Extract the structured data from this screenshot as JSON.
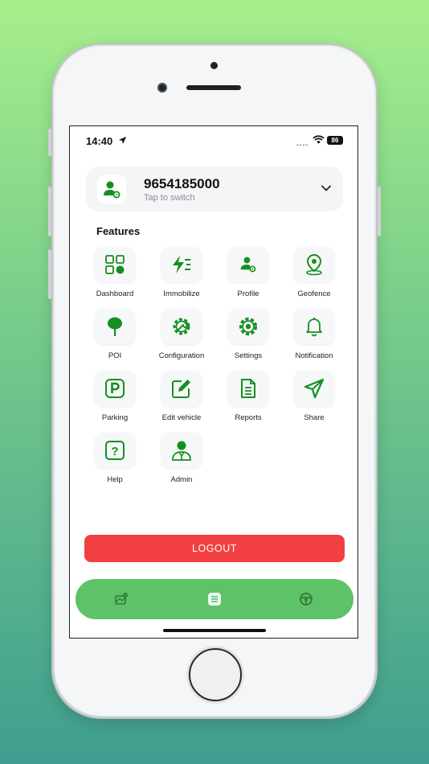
{
  "status": {
    "time": "14:40",
    "battery": "86"
  },
  "account": {
    "phone": "9654185000",
    "subtitle": "Tap to switch"
  },
  "features": {
    "title": "Features",
    "items": [
      {
        "label": "Dashboard",
        "icon": "dashboard-icon"
      },
      {
        "label": "Immobilize",
        "icon": "immobilize-icon"
      },
      {
        "label": "Profile",
        "icon": "profile-icon"
      },
      {
        "label": "Geofence",
        "icon": "geofence-icon"
      },
      {
        "label": "POI",
        "icon": "poi-icon"
      },
      {
        "label": "Configuration",
        "icon": "configuration-icon"
      },
      {
        "label": "Settings",
        "icon": "settings-icon"
      },
      {
        "label": "Notification",
        "icon": "notification-icon"
      },
      {
        "label": "Parking",
        "icon": "parking-icon"
      },
      {
        "label": "Edit vehicle",
        "icon": "edit-vehicle-icon"
      },
      {
        "label": "Reports",
        "icon": "reports-icon"
      },
      {
        "label": "Share",
        "icon": "share-icon"
      },
      {
        "label": "Help",
        "icon": "help-icon"
      },
      {
        "label": "Admin",
        "icon": "admin-icon"
      }
    ]
  },
  "logout": {
    "label": "LOGOUT"
  },
  "colors": {
    "accent": "#14901f",
    "logout": "#f23f42",
    "nav": "#5ec268"
  }
}
